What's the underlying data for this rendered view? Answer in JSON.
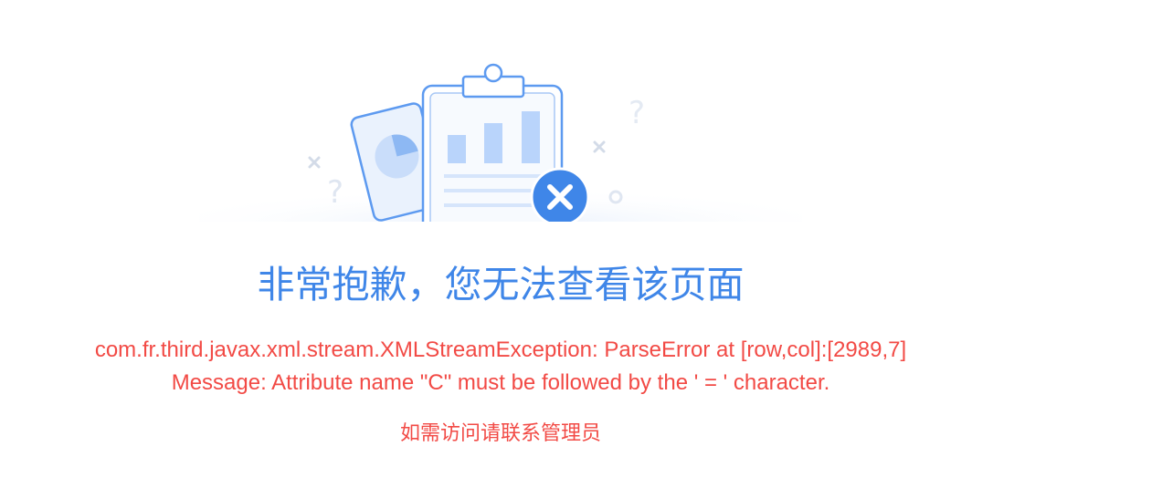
{
  "illustration": {
    "icon": "clipboard-chart-error-illustration",
    "close_icon": "close-icon",
    "colors": {
      "primary": "#3f86e8",
      "light": "#b9d4fb",
      "error_badge": "#3f86e8"
    }
  },
  "message": {
    "title": "非常抱歉，您无法查看该页面",
    "error_line1": "com.fr.third.javax.xml.stream.XMLStreamException: ParseError at [row,col]:[2989,7]",
    "error_line2": "Message: Attribute name \"C\" must be followed by the ' = ' character.",
    "contact": "如需访问请联系管理员"
  },
  "colors": {
    "title": "#3f86e8",
    "error": "#f24a45",
    "background": "#ffffff"
  }
}
